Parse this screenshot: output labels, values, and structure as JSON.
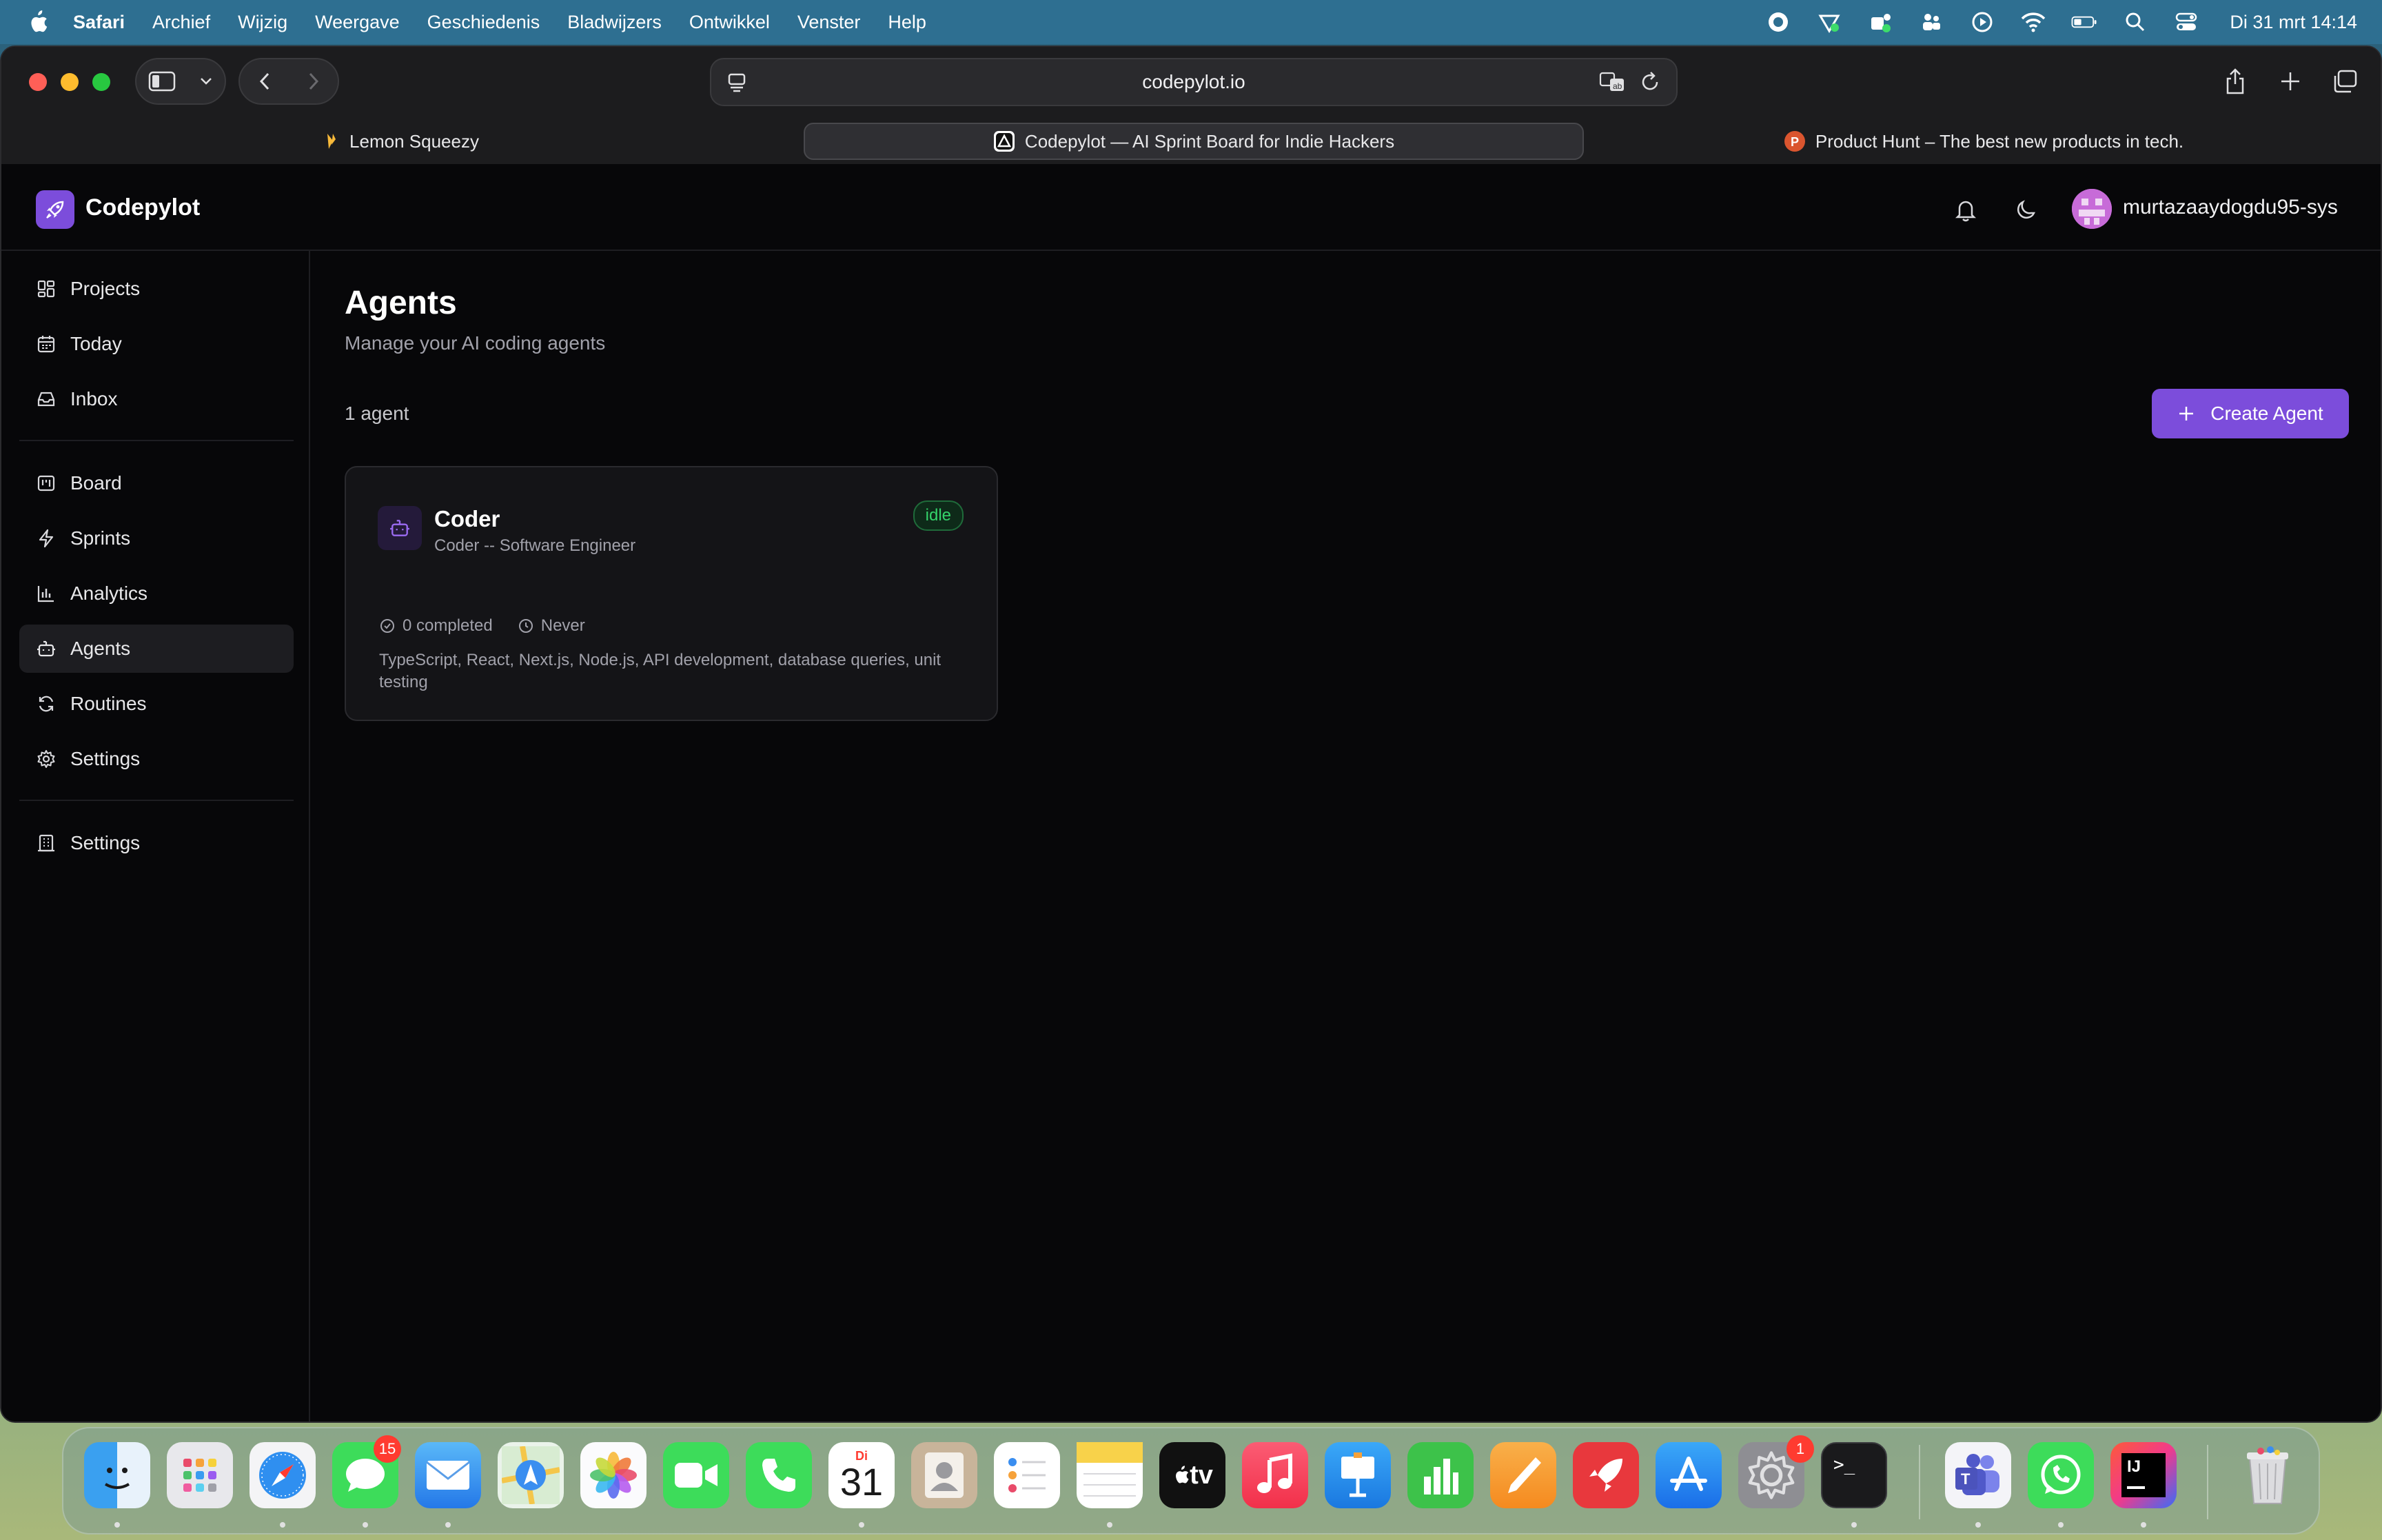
{
  "menubar": {
    "app": "Safari",
    "items": [
      "Archief",
      "Wijzig",
      "Weergave",
      "Geschiedenis",
      "Bladwijzers",
      "Ontwikkel",
      "Venster",
      "Help"
    ],
    "clock": "Di 31 mrt  14:14"
  },
  "browser": {
    "url": "codepylot.io",
    "tabs": [
      {
        "title": "Lemon Squeezy"
      },
      {
        "title": "Codepylot — AI Sprint Board for Indie Hackers"
      },
      {
        "title": "Product Hunt – The best new products in tech."
      }
    ]
  },
  "app": {
    "brand": "Codepylot",
    "username": "murtazaaydogdu95-sys",
    "sidebar": [
      {
        "label": "Projects",
        "icon": "grid-icon"
      },
      {
        "label": "Today",
        "icon": "calendar-icon"
      },
      {
        "label": "Inbox",
        "icon": "inbox-icon"
      },
      {
        "label": "Board",
        "icon": "kanban-icon"
      },
      {
        "label": "Sprints",
        "icon": "bolt-icon"
      },
      {
        "label": "Analytics",
        "icon": "bar-chart-icon"
      },
      {
        "label": "Agents",
        "icon": "bot-icon"
      },
      {
        "label": "Routines",
        "icon": "refresh-icon"
      },
      {
        "label": "Settings",
        "icon": "gear-icon"
      },
      {
        "label": "Settings",
        "icon": "building-icon"
      }
    ],
    "page": {
      "title": "Agents",
      "subtitle": "Manage your AI coding agents",
      "count": "1 agent",
      "create_label": "Create Agent"
    },
    "agent": {
      "name": "Coder",
      "role": "Coder -- Software Engineer",
      "status": "idle",
      "completed": "0 completed",
      "last_run": "Never",
      "skills": "TypeScript, React, Next.js, Node.js, API development, database queries, unit testing"
    }
  },
  "dock": {
    "messages_badge": "15",
    "calendar_day": "Di",
    "calendar_date": "31",
    "settings_badge": "1",
    "tv_label": "tv",
    "terminal_label": ">_",
    "ij_label": "IJ"
  },
  "colors": {
    "accent": "#7c4ddb",
    "status_idle": "#34d36a",
    "background": "#070709"
  }
}
